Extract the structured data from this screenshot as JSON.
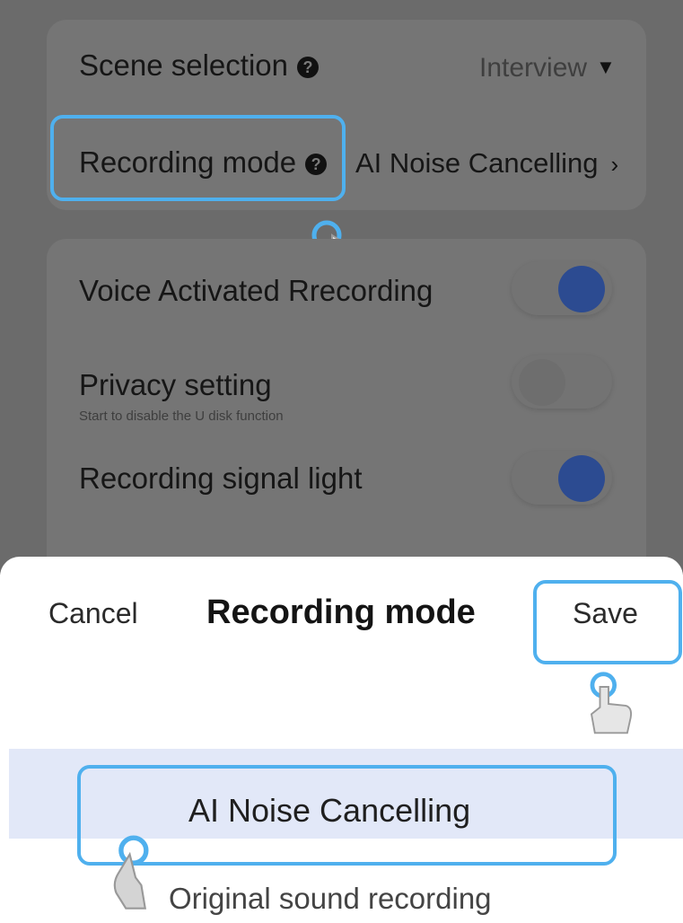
{
  "settings": {
    "scene_selection": {
      "label": "Scene selection",
      "value": "Interview"
    },
    "recording_mode": {
      "label": "Recording mode",
      "value": "AI Noise Cancelling"
    },
    "voice_activated": {
      "label": "Voice Activated Rrecording",
      "on": true
    },
    "privacy": {
      "label": "Privacy setting",
      "sublabel": "Start to disable the U disk function",
      "on": false
    },
    "signal_light": {
      "label": "Recording signal light",
      "on": true
    }
  },
  "sheet": {
    "cancel_label": "Cancel",
    "title": "Recording mode",
    "save_label": "Save",
    "options": [
      {
        "label": "AI Noise Cancelling",
        "selected": true
      },
      {
        "label": "Original sound recording",
        "selected": false
      }
    ]
  },
  "colors": {
    "highlight": "#4fb0ee",
    "toggle_on": "#2c4b91",
    "selected_band": "#e2e8f8"
  },
  "icons": [
    "help-icon",
    "caret-down-icon",
    "chevron-right-icon",
    "hand-pointer-icon"
  ]
}
